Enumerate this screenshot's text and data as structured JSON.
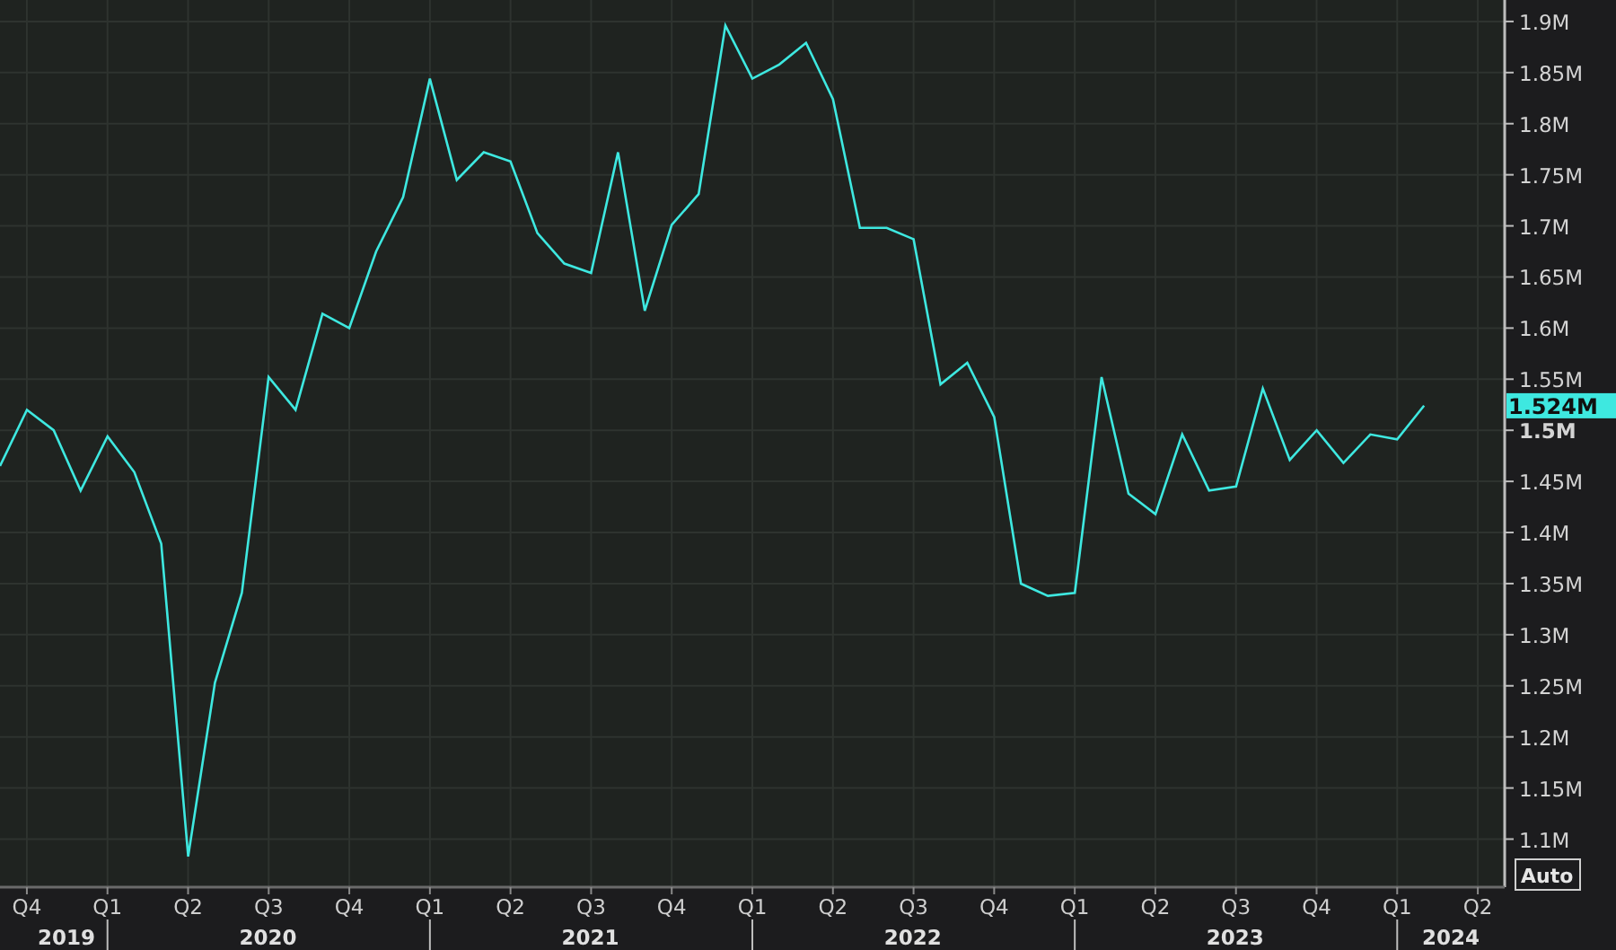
{
  "chart_data": {
    "type": "line",
    "x": [
      "2019-09",
      "2019-10",
      "2019-11",
      "2019-12",
      "2020-01",
      "2020-02",
      "2020-03",
      "2020-04",
      "2020-05",
      "2020-06",
      "2020-07",
      "2020-08",
      "2020-09",
      "2020-10",
      "2020-11",
      "2020-12",
      "2021-01",
      "2021-02",
      "2021-03",
      "2021-04",
      "2021-05",
      "2021-06",
      "2021-07",
      "2021-08",
      "2021-09",
      "2021-10",
      "2021-11",
      "2021-12",
      "2022-01",
      "2022-02",
      "2022-03",
      "2022-04",
      "2022-05",
      "2022-06",
      "2022-07",
      "2022-08",
      "2022-09",
      "2022-10",
      "2022-11",
      "2022-12",
      "2023-01",
      "2023-02",
      "2023-03",
      "2023-04",
      "2023-05",
      "2023-06",
      "2023-07",
      "2023-08",
      "2023-09",
      "2023-10",
      "2023-11",
      "2023-12",
      "2024-01",
      "2024-02"
    ],
    "series": [
      {
        "color": "#3ee8e0",
        "values": [
          1.465,
          1.52,
          1.5,
          1.441,
          1.494,
          1.459,
          1.389,
          1.083,
          1.253,
          1.341,
          1.552,
          1.52,
          1.614,
          1.6,
          1.675,
          1.728,
          1.844,
          1.745,
          1.772,
          1.763,
          1.693,
          1.663,
          1.654,
          1.772,
          1.617,
          1.701,
          1.731,
          1.896,
          1.844,
          1.858,
          1.879,
          1.824,
          1.698,
          1.698,
          1.687,
          1.545,
          1.566,
          1.513,
          1.35,
          1.338,
          1.341,
          1.552,
          1.438,
          1.418,
          1.496,
          1.441,
          1.445,
          1.541,
          1.471,
          1.5,
          1.468,
          1.496,
          1.491,
          1.524
        ]
      }
    ],
    "value_labels": [
      null,
      null,
      null,
      null,
      null,
      null,
      null,
      null,
      null,
      null,
      null,
      null,
      null,
      null,
      null,
      null,
      null,
      null,
      null,
      null,
      null,
      null,
      null,
      null,
      null,
      null,
      null,
      null,
      null,
      null,
      null,
      null,
      null,
      null,
      null,
      null,
      null,
      null,
      null,
      null,
      null,
      null,
      null,
      null,
      null,
      null,
      null,
      null,
      null,
      null,
      null,
      null,
      null,
      "1.524M"
    ],
    "xlim": [
      "2019-09",
      "2024-05"
    ],
    "ylim": [
      1.053,
      1.921
    ],
    "grid": true,
    "yticks": [
      {
        "value": 1.9,
        "label": "1.9M"
      },
      {
        "value": 1.85,
        "label": "1.85M"
      },
      {
        "value": 1.8,
        "label": "1.8M"
      },
      {
        "value": 1.75,
        "label": "1.75M"
      },
      {
        "value": 1.7,
        "label": "1.7M"
      },
      {
        "value": 1.65,
        "label": "1.65M"
      },
      {
        "value": 1.6,
        "label": "1.6M"
      },
      {
        "value": 1.55,
        "label": "1.55M"
      },
      {
        "value": 1.5,
        "label": "1.5M"
      },
      {
        "value": 1.45,
        "label": "1.45M"
      },
      {
        "value": 1.4,
        "label": "1.4M"
      },
      {
        "value": 1.35,
        "label": "1.35M"
      },
      {
        "value": 1.3,
        "label": "1.3M"
      },
      {
        "value": 1.25,
        "label": "1.25M"
      },
      {
        "value": 1.2,
        "label": "1.2M"
      },
      {
        "value": 1.15,
        "label": "1.15M"
      },
      {
        "value": 1.1,
        "label": "1.1M"
      }
    ],
    "xticks": [
      {
        "value": "2019-10",
        "label": "Q4"
      },
      {
        "value": "2020-01",
        "label": "Q1"
      },
      {
        "value": "2020-04",
        "label": "Q2"
      },
      {
        "value": "2020-07",
        "label": "Q3"
      },
      {
        "value": "2020-10",
        "label": "Q4"
      },
      {
        "value": "2021-01",
        "label": "Q1"
      },
      {
        "value": "2021-04",
        "label": "Q2"
      },
      {
        "value": "2021-07",
        "label": "Q3"
      },
      {
        "value": "2021-10",
        "label": "Q4"
      },
      {
        "value": "2022-01",
        "label": "Q1"
      },
      {
        "value": "2022-04",
        "label": "Q2"
      },
      {
        "value": "2022-07",
        "label": "Q3"
      },
      {
        "value": "2022-10",
        "label": "Q4"
      },
      {
        "value": "2023-01",
        "label": "Q1"
      },
      {
        "value": "2023-04",
        "label": "Q2"
      },
      {
        "value": "2023-07",
        "label": "Q3"
      },
      {
        "value": "2023-10",
        "label": "Q4"
      },
      {
        "value": "2024-01",
        "label": "Q1"
      },
      {
        "value": "2024-04",
        "label": "Q2"
      }
    ]
  },
  "year_labels": [
    "2019",
    "2020",
    "2021",
    "2022",
    "2023",
    "2024"
  ],
  "scale_button": "Auto"
}
